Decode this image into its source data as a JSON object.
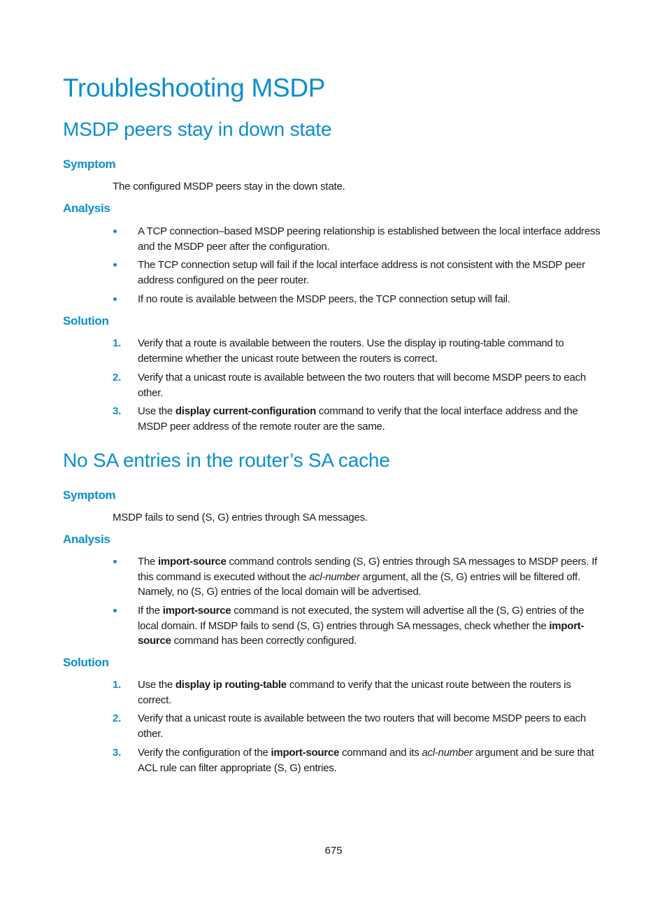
{
  "page_title": "Troubleshooting MSDP",
  "sections": [
    {
      "title": "MSDP peers stay in down state",
      "symptom_heading": "Symptom",
      "symptom_text": "The configured MSDP peers stay in the down state.",
      "analysis_heading": "Analysis",
      "analysis_bullets": [
        {
          "parts": [
            "A TCP connection–based MSDP peering relationship is established between the local interface address and the MSDP peer after the configuration."
          ]
        },
        {
          "parts": [
            "The TCP connection setup will fail if the local interface address is not consistent with the MSDP peer address configured on the peer router."
          ]
        },
        {
          "parts": [
            "If no route is available between the MSDP peers, the TCP connection setup will fail."
          ]
        }
      ],
      "solution_heading": "Solution",
      "solution_steps": [
        {
          "number": "1.",
          "text": "Verify that a route is available between the routers. Use the display ip routing-table command to determine whether the unicast route between the routers is correct."
        },
        {
          "number": "2.",
          "text": "Verify that a unicast route is available between the two routers that will become MSDP peers to each other."
        },
        {
          "number": "3.",
          "pre": "Use the ",
          "bold": "display current-configuration",
          "post": " command to verify that the local interface address and the MSDP peer address of the remote router are the same."
        }
      ]
    },
    {
      "title": "No SA entries in the router’s SA cache",
      "symptom_heading": "Symptom",
      "symptom_text": "MSDP fails to send (S, G) entries through SA messages.",
      "analysis_heading": "Analysis",
      "analysis_bullets": [
        {
          "pre": "The ",
          "bold": "import-source",
          "mid": " command controls sending (S, G) entries through SA messages to MSDP peers. If this command is executed without the ",
          "italic": "acl-number",
          "post": " argument, all the (S, G) entries will be filtered off. Namely, no (S, G) entries of the local domain will be advertised."
        },
        {
          "pre": "If the ",
          "bold": "import-source",
          "mid": " command is not executed, the system will advertise all the (S, G) entries of the local domain. If MSDP fails to send (S, G) entries through SA messages, check whether the ",
          "bold2": "import-source",
          "post": " command has been correctly configured."
        }
      ],
      "solution_heading": "Solution",
      "solution_steps": [
        {
          "number": "1.",
          "pre": "Use the ",
          "bold": "display ip routing-table",
          "post": " command to verify that the unicast route between the routers is correct."
        },
        {
          "number": "2.",
          "text": "Verify that a unicast route is available between the two routers that will become MSDP peers to each other."
        },
        {
          "number": "3.",
          "pre": "Verify the configuration of the ",
          "bold": "import-source",
          "mid": " command and its ",
          "italic": "acl-number",
          "post": " argument and be sure that ACL rule can filter appropriate (S, G) entries."
        }
      ]
    }
  ],
  "page_number": "675",
  "colors": {
    "accent": "#0b8fcc",
    "text": "#1a1a1a"
  }
}
